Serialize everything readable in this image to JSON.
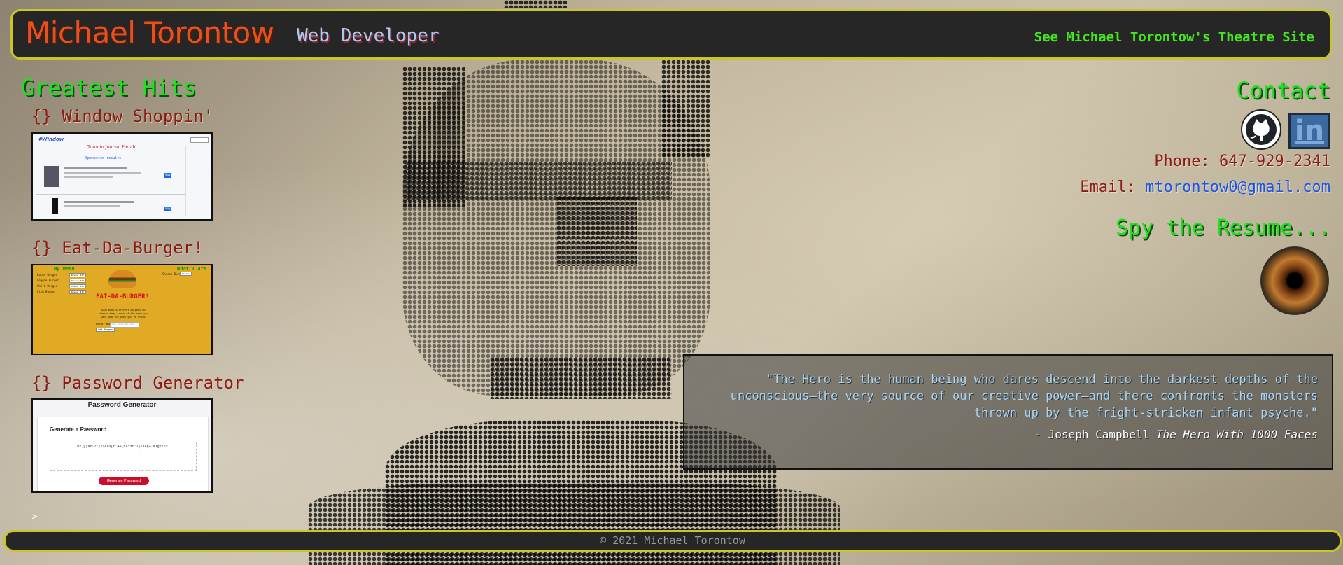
{
  "header": {
    "name": "Michael Torontow",
    "tagline": "Web Developer",
    "theatre_link": "See Michael Torontow's Theatre Site"
  },
  "greatest_hits": {
    "title": "Greatest Hits",
    "projects": [
      {
        "title": "{} Window Shoppin'",
        "thumbnail": {
          "logo": "#Window",
          "heading": "Toronto Journal Herald",
          "subheading": "Sponsored results",
          "buttons": [
            "Buy",
            "Buy"
          ]
        }
      },
      {
        "title": "{} Eat-Da-Burger!",
        "thumbnail": {
          "menu_title": "My Menu",
          "eaten_title": "What I Ate",
          "brand": "EAT-DA-BURGER!",
          "blurb": "SOOO many different burgers out there! Keep track of the ones you want AND the ones you've tried!",
          "input_label": "Burger Name",
          "input_placeholder": "Enter a burger name",
          "add_button": "Add Burger",
          "menu_items": [
            "Bacon Burger",
            "Veggie Burger",
            "Chili Burger",
            "Fish Burger"
          ],
          "devour_label": "Devour It!",
          "eaten_items": [
            "Cheese Burger"
          ],
          "delete_label": "Delete"
        }
      },
      {
        "title": "{} Password Generator",
        "thumbnail": {
          "header": "Password Generator",
          "card_title": "Generate a Password",
          "password": "bx,y)acC2^j2z<au[r'4+(da*zr^7|TXkg+'a1g??u~",
          "button": "Generate Password"
        }
      }
    ]
  },
  "contact": {
    "title": "Contact",
    "github_icon": "github-icon",
    "linkedin_icon": "in",
    "phone_label": "Phone:",
    "phone": "647-929-2341",
    "email_label": "Email:",
    "email": "mtorontow0@gmail.com",
    "resume_title": "Spy the Resume...",
    "resume_icon": "eye-icon"
  },
  "quote": {
    "text": "\"The Hero is the human being who dares descend into the darkest depths of the unconscious—the very source of our creative power—and there confronts the monsters thrown up by the fright-stricken infant psyche.\"",
    "attribution": "- Joseph Campbell",
    "book": "The Hero With 1000 Faces"
  },
  "stray_comment": "-->",
  "footer": {
    "copyright": "© 2021 Michael Torontow"
  },
  "colors": {
    "header_bg": "#262626",
    "border": "#c8c628",
    "name": "#e8501c",
    "green": "#22dd22",
    "maroon": "#8a1a18",
    "link_blue": "#1a55e8"
  }
}
